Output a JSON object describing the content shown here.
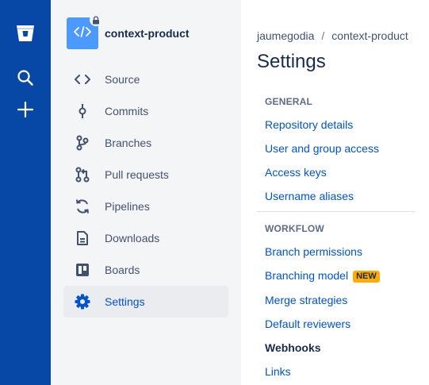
{
  "global_nav": {
    "icons": [
      "bitbucket-logo-icon",
      "search-icon",
      "plus-icon"
    ]
  },
  "repo": {
    "name": "context-product",
    "avatar_icon": "code-icon",
    "private_icon": "lock-icon"
  },
  "sidebar": {
    "items": [
      {
        "label": "Source",
        "icon": "source-code-icon"
      },
      {
        "label": "Commits",
        "icon": "commit-icon"
      },
      {
        "label": "Branches",
        "icon": "branch-icon"
      },
      {
        "label": "Pull requests",
        "icon": "pull-request-icon"
      },
      {
        "label": "Pipelines",
        "icon": "pipelines-icon"
      },
      {
        "label": "Downloads",
        "icon": "downloads-icon"
      },
      {
        "label": "Boards",
        "icon": "boards-icon"
      },
      {
        "label": "Settings",
        "icon": "settings-icon",
        "active": true
      }
    ]
  },
  "breadcrumb": {
    "user": "jaumegodia",
    "separator": "/",
    "repo": "context-product"
  },
  "page": {
    "title": "Settings"
  },
  "sections": {
    "general": {
      "heading": "GENERAL",
      "links": [
        "Repository details",
        "User and group access",
        "Access keys",
        "Username aliases"
      ]
    },
    "workflow": {
      "heading": "WORKFLOW",
      "links": [
        "Branch permissions",
        "Branching model",
        "Merge strategies",
        "Default reviewers",
        "Webhooks",
        "Links"
      ],
      "new_badge": "NEW",
      "current": "Webhooks"
    }
  },
  "colors": {
    "global_nav": "#0747a6",
    "sidebar_bg": "#f4f5f7",
    "link": "#0052cc",
    "badge": "#ffab00",
    "active_bg": "#ebecf0"
  }
}
